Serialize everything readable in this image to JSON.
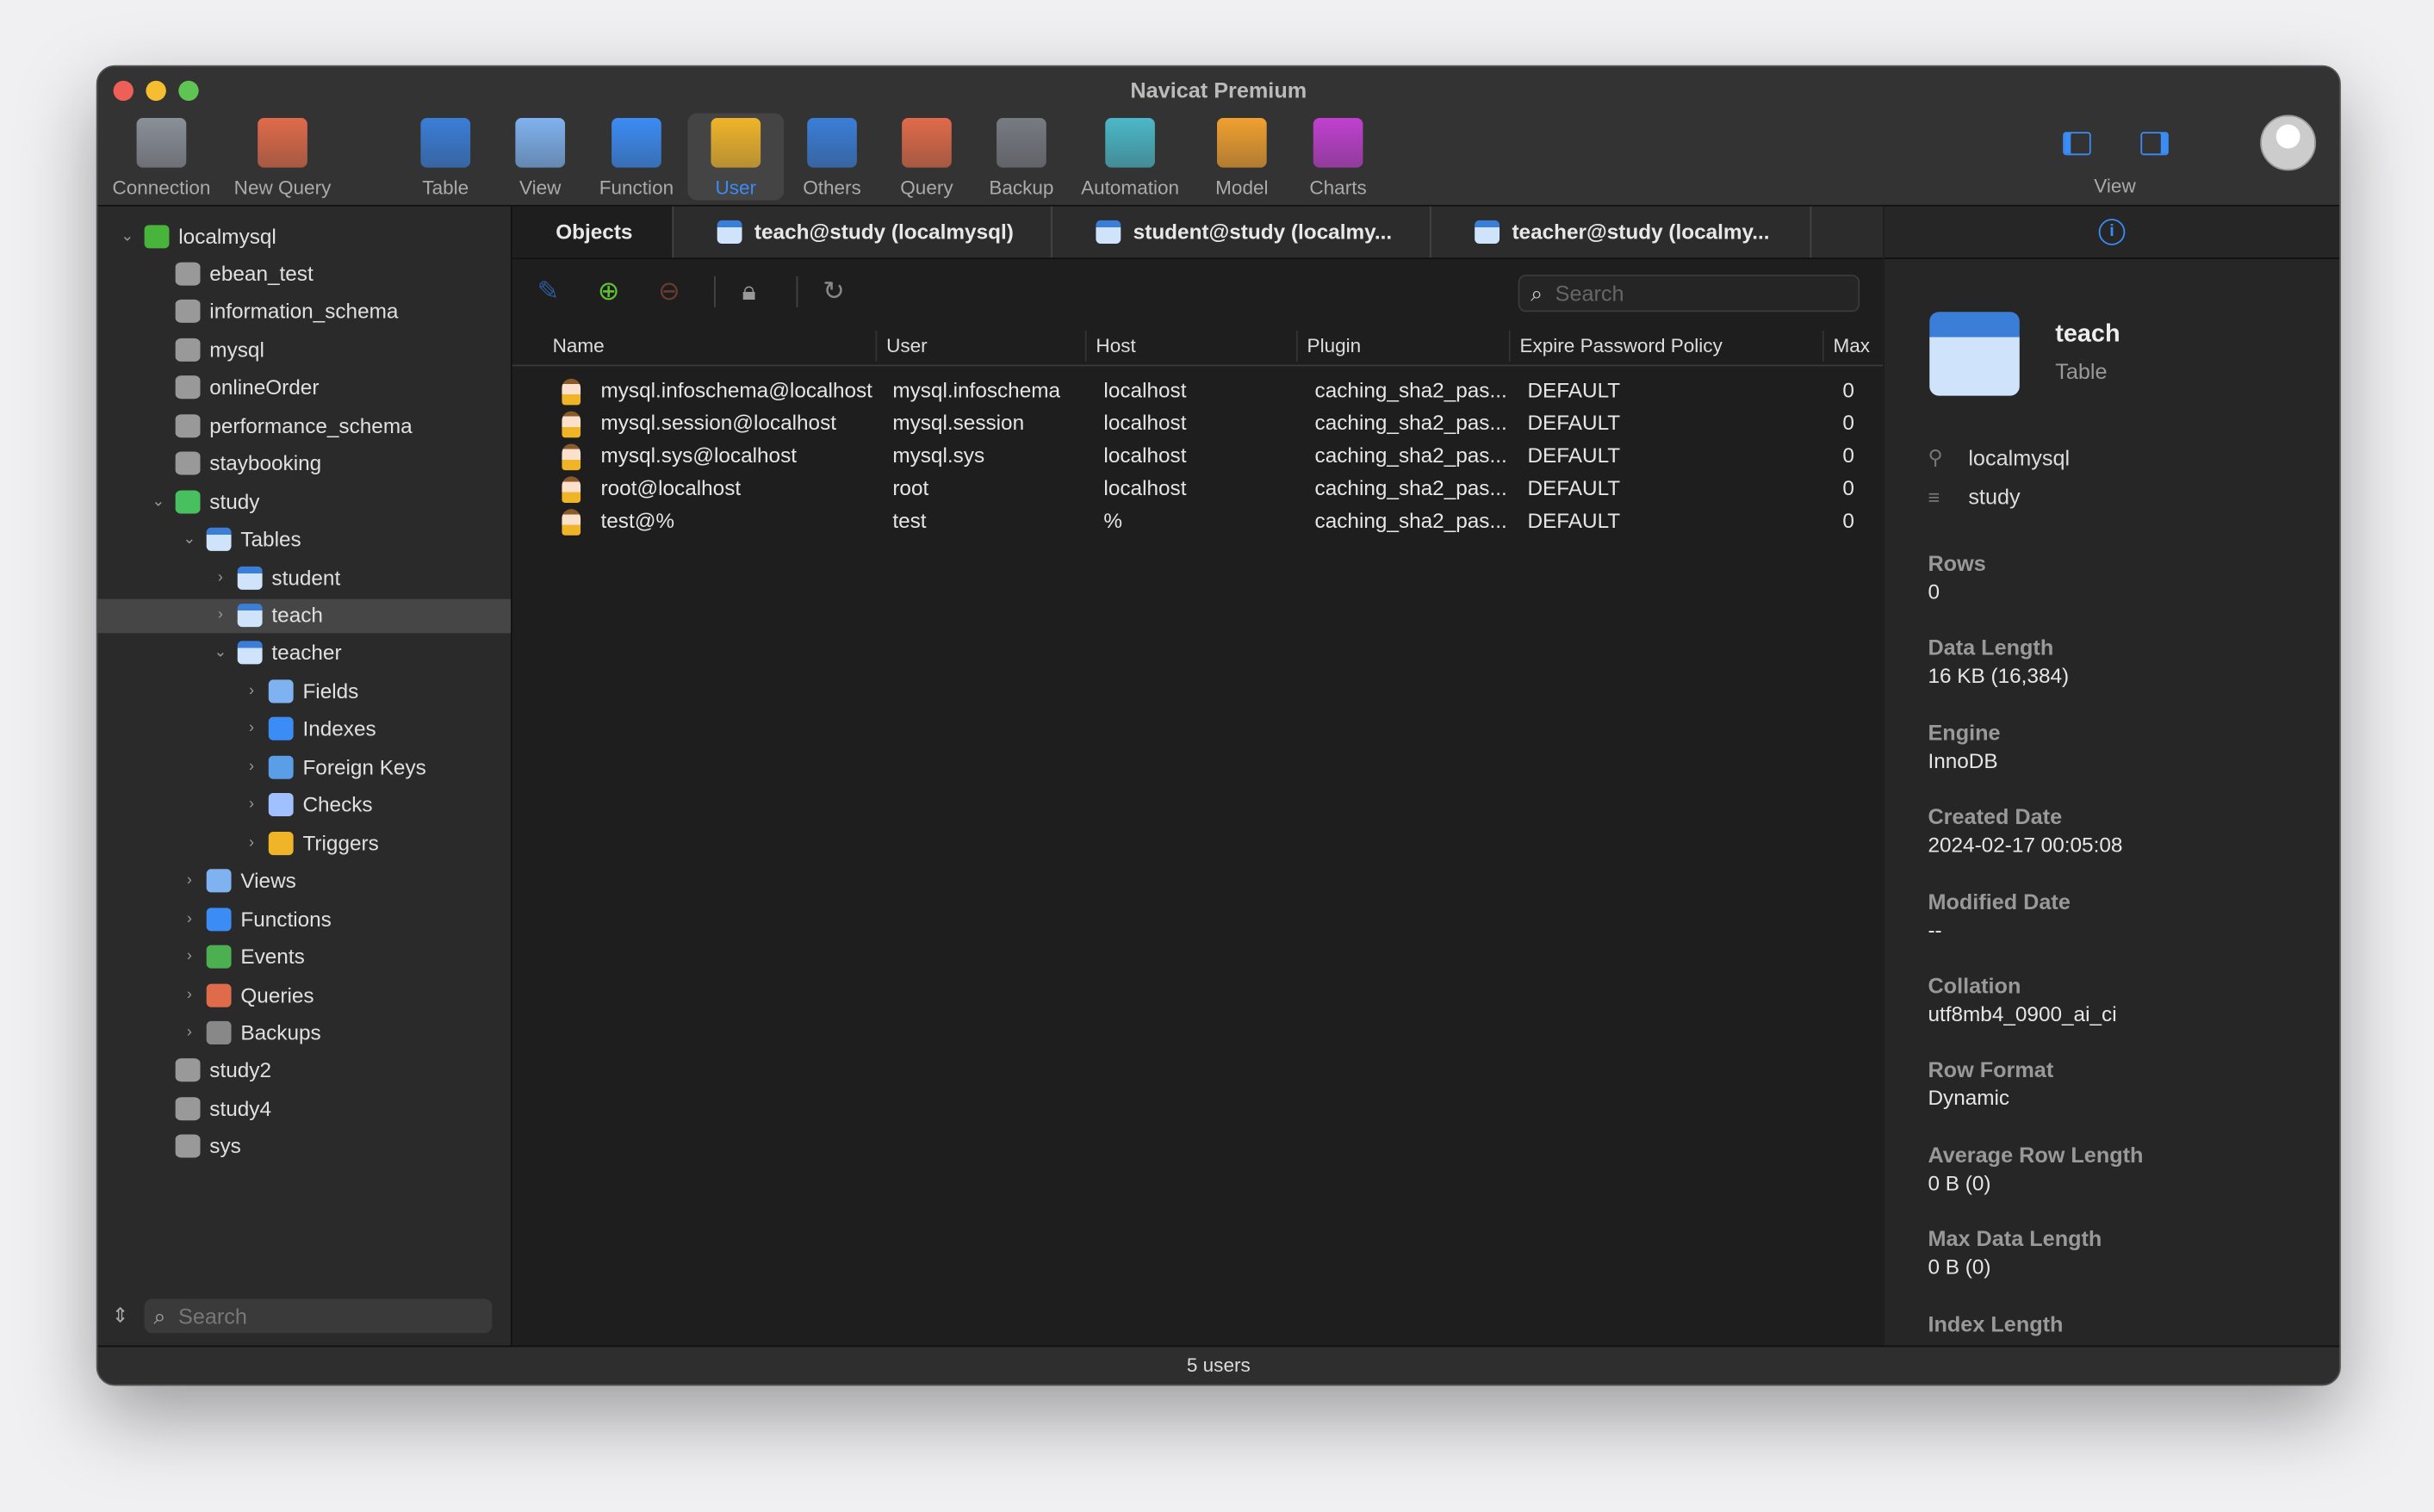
{
  "window": {
    "title": "Navicat Premium"
  },
  "toolbar": {
    "items": [
      {
        "label": "Connection",
        "icon": "connection-icon",
        "color": "#8a8f98"
      },
      {
        "label": "New Query",
        "icon": "new-query-icon",
        "color": "#e06b4a"
      },
      {
        "label": "Table",
        "icon": "table-icon",
        "color": "#3a7ed8"
      },
      {
        "label": "View",
        "icon": "view-icon",
        "color": "#7fb2f0"
      },
      {
        "label": "Function",
        "icon": "function-icon",
        "color": "#3b8cf5"
      },
      {
        "label": "User",
        "icon": "user-icon",
        "color": "#f0b429"
      },
      {
        "label": "Others",
        "icon": "others-icon",
        "color": "#3a7ed8"
      },
      {
        "label": "Query",
        "icon": "query-icon",
        "color": "#e06b4a"
      },
      {
        "label": "Backup",
        "icon": "backup-icon",
        "color": "#777b82"
      },
      {
        "label": "Automation",
        "icon": "automation-icon",
        "color": "#4bb8c8"
      },
      {
        "label": "Model",
        "icon": "model-icon",
        "color": "#f0a030"
      },
      {
        "label": "Charts",
        "icon": "charts-icon",
        "color": "#c040d0"
      }
    ],
    "view_label": "View"
  },
  "sidebar": {
    "tree": [
      {
        "label": "localmysql",
        "level": 0,
        "chev": "v",
        "icon": "connection"
      },
      {
        "label": "ebean_test",
        "level": 1,
        "icon": "db"
      },
      {
        "label": "information_schema",
        "level": 1,
        "icon": "db"
      },
      {
        "label": "mysql",
        "level": 1,
        "icon": "db"
      },
      {
        "label": "onlineOrder",
        "level": 1,
        "icon": "db"
      },
      {
        "label": "performance_schema",
        "level": 1,
        "icon": "db"
      },
      {
        "label": "staybooking",
        "level": 1,
        "icon": "db"
      },
      {
        "label": "study",
        "level": 1,
        "chev": "v",
        "icon": "db-green"
      },
      {
        "label": "Tables",
        "level": 2,
        "chev": "v",
        "icon": "tbl"
      },
      {
        "label": "student",
        "level": 3,
        "chev": ">",
        "icon": "tbl"
      },
      {
        "label": "teach",
        "level": 3,
        "chev": ">",
        "icon": "tbl",
        "selected": true
      },
      {
        "label": "teacher",
        "level": 3,
        "chev": "v",
        "icon": "tbl"
      },
      {
        "label": "Fields",
        "level": 4,
        "chev": ">",
        "icon": "fields"
      },
      {
        "label": "Indexes",
        "level": 4,
        "chev": ">",
        "icon": "indexes"
      },
      {
        "label": "Foreign Keys",
        "level": 4,
        "chev": ">",
        "icon": "fk"
      },
      {
        "label": "Checks",
        "level": 4,
        "chev": ">",
        "icon": "checks"
      },
      {
        "label": "Triggers",
        "level": 4,
        "chev": ">",
        "icon": "triggers"
      },
      {
        "label": "Views",
        "level": 2,
        "chev": ">",
        "icon": "views"
      },
      {
        "label": "Functions",
        "level": 2,
        "chev": ">",
        "icon": "functions"
      },
      {
        "label": "Events",
        "level": 2,
        "chev": ">",
        "icon": "events"
      },
      {
        "label": "Queries",
        "level": 2,
        "chev": ">",
        "icon": "queries"
      },
      {
        "label": "Backups",
        "level": 2,
        "chev": ">",
        "icon": "backups"
      },
      {
        "label": "study2",
        "level": 1,
        "icon": "db"
      },
      {
        "label": "study4",
        "level": 1,
        "icon": "db"
      },
      {
        "label": "sys",
        "level": 1,
        "icon": "db"
      }
    ],
    "search_placeholder": "Search"
  },
  "tabs": [
    "Objects",
    "teach@study (localmysql)",
    "student@study (localmy...",
    "teacher@study (localmy..."
  ],
  "objects": {
    "search_placeholder": "Search",
    "columns": [
      "Name",
      "User",
      "Host",
      "Plugin",
      "Expire Password Policy",
      "Max"
    ],
    "rows": [
      [
        "mysql.infoschema@localhost",
        "mysql.infoschema",
        "localhost",
        "caching_sha2_pas...",
        "DEFAULT",
        "0"
      ],
      [
        "mysql.session@localhost",
        "mysql.session",
        "localhost",
        "caching_sha2_pas...",
        "DEFAULT",
        "0"
      ],
      [
        "mysql.sys@localhost",
        "mysql.sys",
        "localhost",
        "caching_sha2_pas...",
        "DEFAULT",
        "0"
      ],
      [
        "root@localhost",
        "root",
        "localhost",
        "caching_sha2_pas...",
        "DEFAULT",
        "0"
      ],
      [
        "test@%",
        "test",
        "%",
        "caching_sha2_pas...",
        "DEFAULT",
        "0"
      ]
    ]
  },
  "info": {
    "name": "teach",
    "type": "Table",
    "connection": "localmysql",
    "database": "study",
    "props": [
      {
        "k": "Rows",
        "v": "0"
      },
      {
        "k": "Data Length",
        "v": "16 KB (16,384)"
      },
      {
        "k": "Engine",
        "v": "InnoDB"
      },
      {
        "k": "Created Date",
        "v": "2024-02-17 00:05:08"
      },
      {
        "k": "Modified Date",
        "v": "--"
      },
      {
        "k": "Collation",
        "v": "utf8mb4_0900_ai_ci"
      },
      {
        "k": "Row Format",
        "v": "Dynamic"
      },
      {
        "k": "Average Row Length",
        "v": "0 B (0)"
      },
      {
        "k": "Max Data Length",
        "v": "0 B (0)"
      },
      {
        "k": "Index Length",
        "v": ""
      }
    ]
  },
  "status": "5 users"
}
